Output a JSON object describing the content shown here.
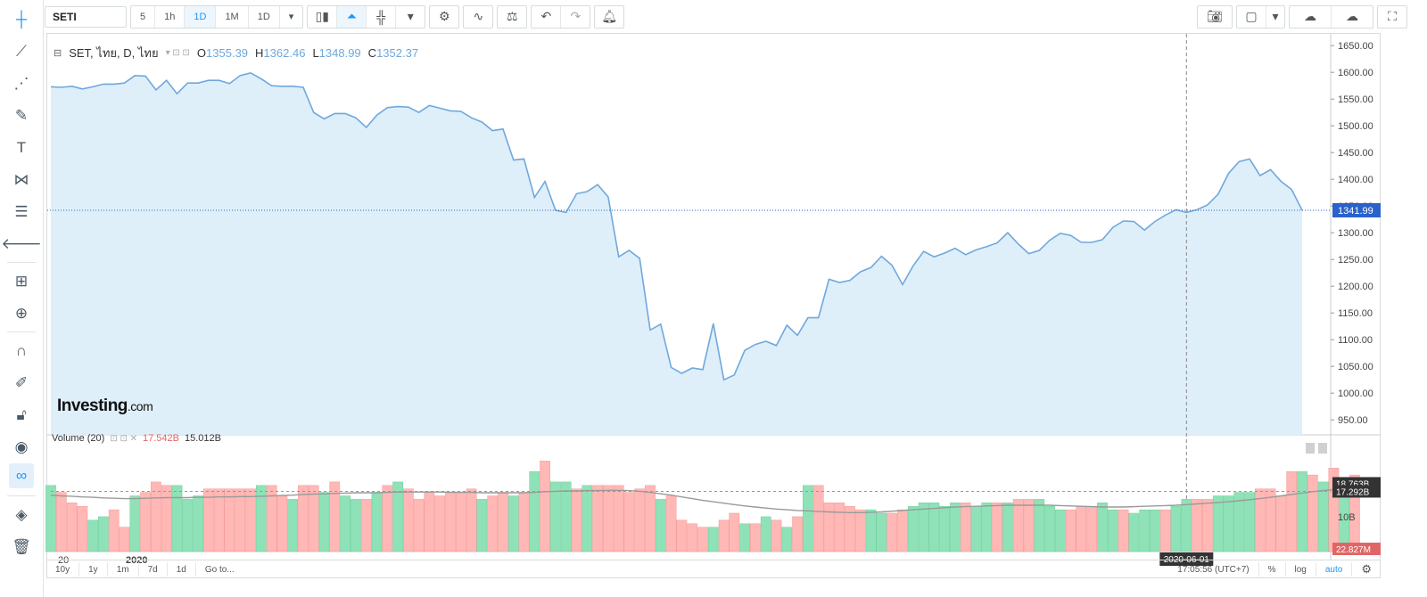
{
  "toolbar": {
    "symbol": "SETI",
    "intervals": [
      "5",
      "1h",
      "1D",
      "1M",
      "1D"
    ],
    "active_interval_index": 2
  },
  "legend": {
    "title": "SET, ไทย, D, ไทย",
    "o_label": "O",
    "o": "1355.39",
    "h_label": "H",
    "h": "1362.46",
    "l_label": "L",
    "l": "1348.99",
    "c_label": "C",
    "c": "1352.37"
  },
  "volume_legend": {
    "title": "Volume (20)",
    "v1": "17.542B",
    "v2": "15.012B"
  },
  "logo": {
    "main": "Investing",
    "suffix": ".com"
  },
  "bottom": {
    "ranges": [
      "10y",
      "1y",
      "1m",
      "7d",
      "1d",
      "Go to..."
    ],
    "time": "17:05:56 (UTC+7)",
    "percent": "%",
    "log": "log",
    "auto": "auto"
  },
  "colors": {
    "line": "#6fa8dc",
    "area": "#deeffa",
    "up": "#8fe2b7",
    "down": "#ffb8b5",
    "last_price": "#2962c9"
  },
  "chart_data": [
    {
      "type": "area",
      "title": "SET, ไทย, D, ไทย",
      "ylim": [
        922,
        1672
      ],
      "y_ticks": [
        950,
        1000,
        1050,
        1100,
        1150,
        1200,
        1250,
        1300,
        1350,
        1400,
        1450,
        1500,
        1550,
        1600,
        1650
      ],
      "x_labels": [
        "20",
        "2020"
      ],
      "crosshair_label": "2020-06-01",
      "last_price_label": "1341.99",
      "last_price": 1341.99,
      "values": [
        1573,
        1572,
        1574,
        1569,
        1573,
        1578,
        1578,
        1580,
        1594,
        1593,
        1567,
        1585,
        1560,
        1580,
        1580,
        1585,
        1585,
        1579,
        1594,
        1599,
        1588,
        1575,
        1574,
        1574,
        1572,
        1525,
        1513,
        1523,
        1523,
        1515,
        1497,
        1520,
        1534,
        1536,
        1535,
        1525,
        1538,
        1533,
        1528,
        1527,
        1515,
        1507,
        1491,
        1494,
        1436,
        1438,
        1366,
        1396,
        1342,
        1338,
        1373,
        1377,
        1390,
        1367,
        1255,
        1267,
        1252,
        1118,
        1129,
        1048,
        1037,
        1047,
        1044,
        1130,
        1025,
        1034,
        1080,
        1091,
        1097,
        1089,
        1127,
        1108,
        1141,
        1141,
        1213,
        1207,
        1211,
        1227,
        1235,
        1256,
        1239,
        1203,
        1238,
        1265,
        1255,
        1262,
        1271,
        1259,
        1268,
        1274,
        1281,
        1300,
        1279,
        1261,
        1267,
        1286,
        1299,
        1295,
        1282,
        1282,
        1287,
        1310,
        1322,
        1321,
        1305,
        1321,
        1333,
        1343,
        1338,
        1343,
        1352,
        1372,
        1411,
        1433,
        1438,
        1407,
        1418,
        1396,
        1381,
        1342
      ]
    },
    {
      "type": "bar",
      "title": "Volume (20)",
      "y_ticks_labels": [
        "10B"
      ],
      "y_tick_values": [
        10
      ],
      "ylim": [
        0,
        32
      ],
      "values": [
        19,
        17,
        14,
        13,
        9,
        10,
        12,
        7,
        16,
        17,
        20,
        19,
        19,
        15,
        16,
        18,
        18,
        18,
        18,
        18,
        19,
        19,
        16,
        15,
        19,
        19,
        17,
        20,
        16,
        15,
        15,
        17,
        19,
        20,
        18,
        15,
        17,
        16,
        17,
        17,
        18,
        15,
        16,
        17,
        16,
        17,
        23,
        26,
        20,
        20,
        18,
        19,
        19,
        19,
        19,
        17,
        18,
        19,
        15,
        16,
        9,
        8,
        7,
        7,
        9,
        11,
        8,
        8,
        10,
        9,
        7,
        10,
        19,
        19,
        14,
        14,
        13,
        12,
        12,
        11,
        11,
        12,
        13,
        14,
        14,
        13,
        14,
        14,
        13,
        14,
        14,
        14,
        15,
        15,
        15,
        13,
        12,
        12,
        13,
        13,
        14,
        12,
        12,
        11,
        12,
        12,
        12,
        13,
        15,
        15,
        15,
        16,
        16,
        17,
        17,
        18,
        18,
        16,
        23,
        23,
        22,
        20,
        24,
        20,
        22
      ],
      "up": [
        1,
        0,
        0,
        0,
        1,
        1,
        0,
        0,
        1,
        0,
        0,
        0,
        1,
        1,
        1,
        0,
        0,
        0,
        0,
        0,
        1,
        0,
        0,
        1,
        0,
        0,
        1,
        0,
        1,
        1,
        0,
        1,
        0,
        1,
        0,
        0,
        0,
        0,
        0,
        0,
        0,
        1,
        0,
        0,
        1,
        0,
        1,
        0,
        1,
        1,
        0,
        1,
        0,
        0,
        0,
        0,
        0,
        0,
        1,
        0,
        0,
        0,
        0,
        1,
        0,
        0,
        1,
        0,
        1,
        0,
        1,
        0,
        1,
        0,
        0,
        0,
        0,
        0,
        1,
        1,
        0,
        0,
        1,
        1,
        1,
        1,
        1,
        0,
        1,
        1,
        0,
        1,
        0,
        0,
        1,
        1,
        1,
        0,
        0,
        0,
        1,
        1,
        0,
        1,
        1,
        1,
        0,
        1,
        1,
        0,
        0,
        1,
        1,
        1,
        1,
        0,
        0,
        0,
        0,
        1,
        0,
        1,
        0,
        1
      ],
      "ma_values": [
        16.2,
        16.0,
        15.9,
        15.7,
        15.6,
        15.4,
        15.3,
        15.2,
        15.2,
        15.3,
        15.4,
        15.5,
        15.5,
        15.5,
        15.6,
        15.6,
        15.7,
        15.7,
        15.8,
        15.8,
        15.9,
        16.0,
        16.1,
        16.2,
        16.4,
        16.5,
        16.6,
        16.7,
        16.8,
        16.9,
        16.9,
        16.9,
        17.0,
        17.1,
        17.1,
        17.1,
        17.1,
        17.1,
        17.0,
        17.0,
        17.0,
        16.9,
        16.9,
        16.9,
        16.9,
        16.9,
        17.0,
        17.2,
        17.3,
        17.4,
        17.4,
        17.5,
        17.5,
        17.6,
        17.6,
        17.5,
        17.3,
        17.0,
        16.6,
        16.2,
        15.7,
        15.2,
        14.7,
        14.3,
        13.9,
        13.5,
        13.1,
        12.8,
        12.5,
        12.2,
        12.0,
        11.8,
        11.7,
        11.5,
        11.4,
        11.3,
        11.2,
        11.2,
        11.3,
        11.4,
        11.6,
        11.8,
        12.0,
        12.2,
        12.4,
        12.6,
        12.8,
        12.9,
        13.0,
        13.1,
        13.2,
        13.3,
        13.3,
        13.3,
        13.3,
        13.3,
        13.2,
        13.1,
        13.0,
        12.9,
        12.8,
        12.8,
        12.8,
        12.9,
        13.0,
        13.1,
        13.2,
        13.3,
        13.5,
        13.7,
        13.9,
        14.1,
        14.3,
        14.6,
        14.9,
        15.2,
        15.6,
        16.0,
        16.4,
        16.8,
        17.2,
        17.5,
        17.8,
        18.0,
        18.2
      ]
    }
  ],
  "volume_axis": {
    "label_top": "18.763B",
    "label_mid": "17.292B",
    "label_bottom": "22.827M",
    "mid_value": 17.292
  }
}
